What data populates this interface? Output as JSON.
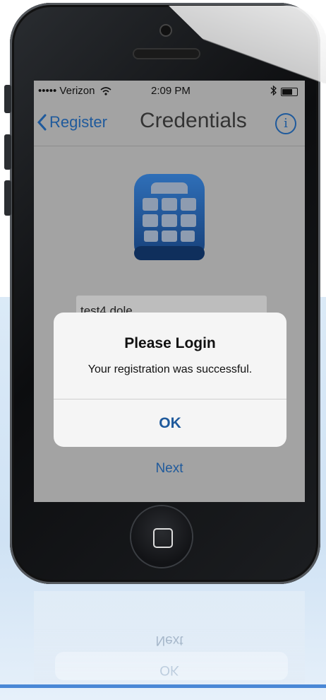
{
  "status_bar": {
    "carrier": "••••• Verizon",
    "time": "2:09 PM"
  },
  "nav": {
    "back_label": "Register",
    "title": "Credentials"
  },
  "form": {
    "username_value": "test4.dole"
  },
  "alert": {
    "title": "Please Login",
    "message": "Your registration was successful.",
    "ok_label": "OK"
  },
  "next_label": "Next",
  "icons": [
    "wifi-icon",
    "bluetooth-icon",
    "battery-icon",
    "chevron-left-icon",
    "info-icon",
    "app-globe-icon",
    "home-button-icon"
  ],
  "colors": {
    "accent": "#1f5a9c",
    "dim_overlay": "#a3a3a3",
    "alert_bg": "#f5f5f5"
  }
}
